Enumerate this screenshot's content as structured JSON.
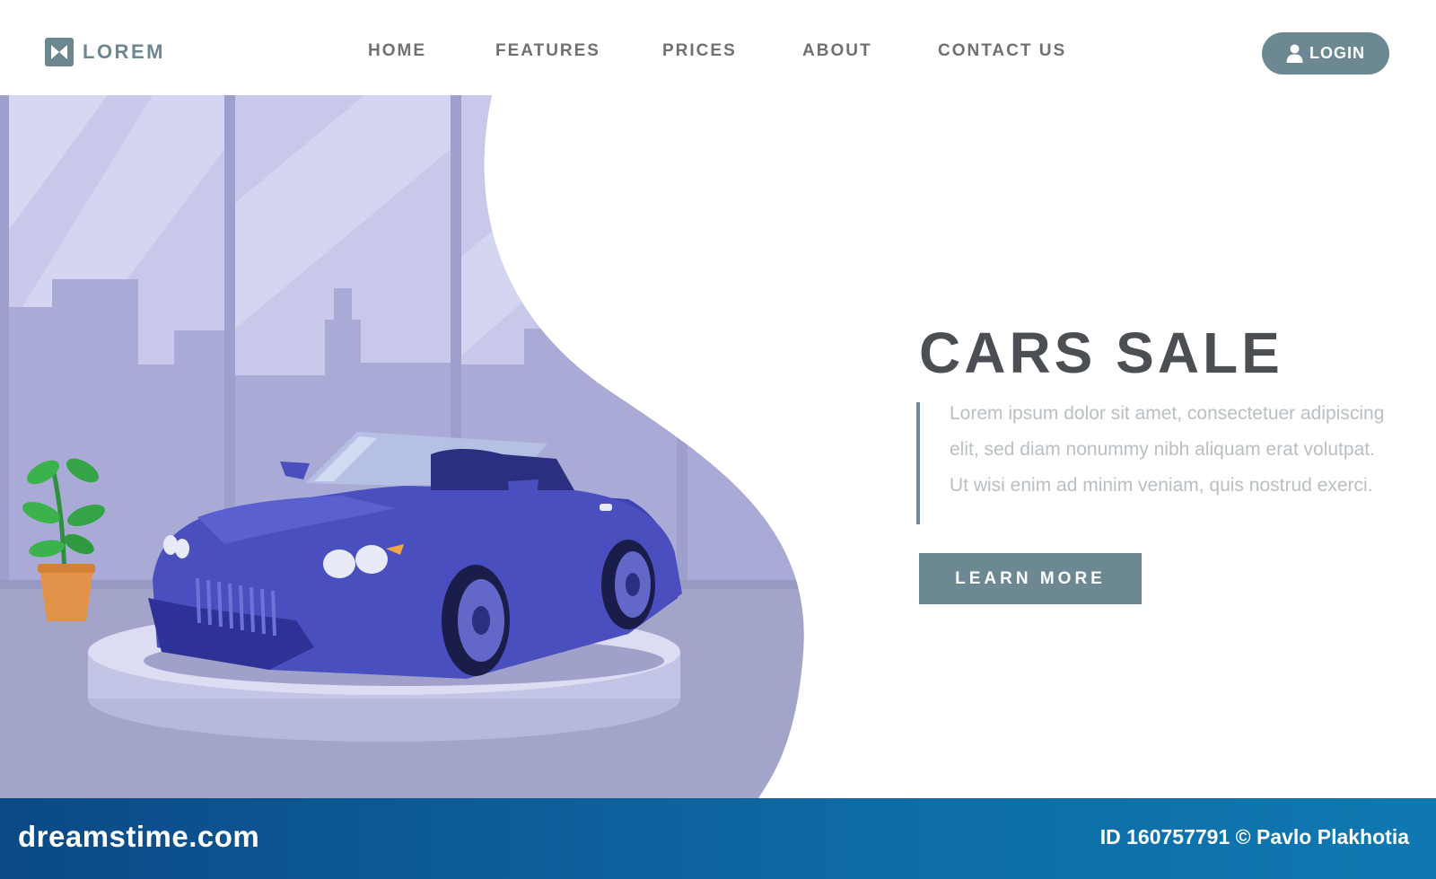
{
  "header": {
    "logo_text": "LOREM",
    "nav": [
      {
        "label": "HOME"
      },
      {
        "label": "FEATURES"
      },
      {
        "label": "PRICES"
      },
      {
        "label": "ABOUT"
      },
      {
        "label": "CONTACT US"
      }
    ],
    "login_label": "LOGIN"
  },
  "hero": {
    "title": "CARS SALE",
    "description": "Lorem ipsum dolor sit amet, consectetuer adipiscing elit, sed diam nonummy nibh aliquam erat volutpat. Ut wisi enim ad minim veniam, quis nostrud exerci.",
    "cta_label": "LEARN MORE"
  },
  "footer": {
    "brand": "dreamstime.com",
    "credit": "ID 160757791 © Pavlo Plakhotia"
  },
  "icons": {
    "logo": "bowtie-logo-icon",
    "login": "user-icon"
  },
  "colors": {
    "accent": "#6c8892",
    "title": "#4b4f53",
    "nav_text": "#6d7173",
    "body_text": "#b9bfc2",
    "car": "#4a4fc0",
    "footer": "#0e6aa5"
  }
}
